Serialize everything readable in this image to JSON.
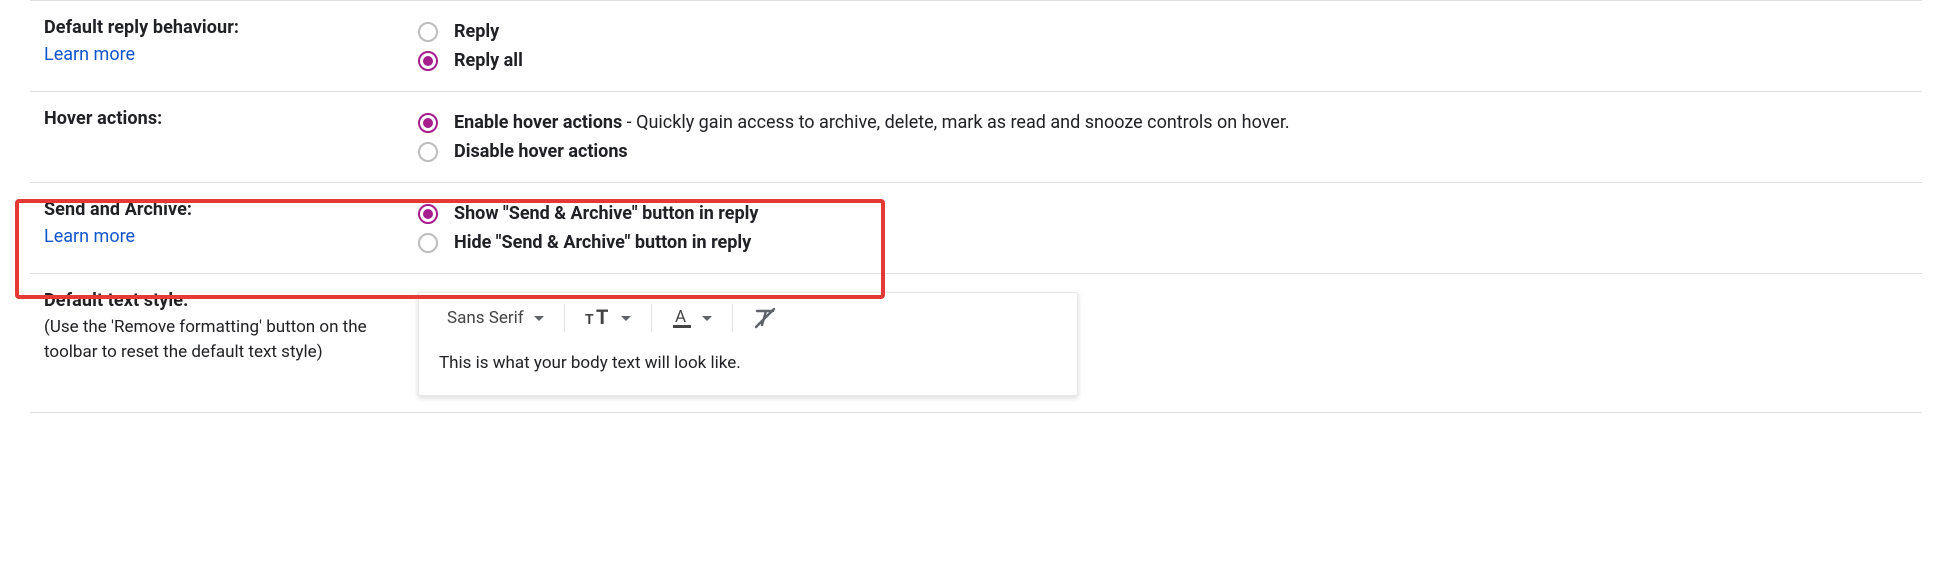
{
  "sections": {
    "reply": {
      "title": "Default reply behaviour:",
      "learn": "Learn more",
      "opts": [
        {
          "label": "Reply",
          "checked": false
        },
        {
          "label": "Reply all",
          "checked": true
        }
      ]
    },
    "hover": {
      "title": "Hover actions:",
      "opts": [
        {
          "bold": "Enable hover actions",
          "desc": " - Quickly gain access to archive, delete, mark as read and snooze controls on hover.",
          "checked": true
        },
        {
          "bold": "Disable hover actions",
          "desc": "",
          "checked": false
        }
      ]
    },
    "sendarchive": {
      "title": "Send and Archive:",
      "learn": "Learn more",
      "opts": [
        {
          "label": "Show \"Send & Archive\" button in reply",
          "checked": true
        },
        {
          "label": "Hide \"Send & Archive\" button in reply",
          "checked": false
        }
      ]
    },
    "textstyle": {
      "title": "Default text style:",
      "sub": "(Use the 'Remove formatting' button on the toolbar to reset the default text style)",
      "font_family": "Sans Serif",
      "preview": "This is what your body text will look like."
    }
  }
}
